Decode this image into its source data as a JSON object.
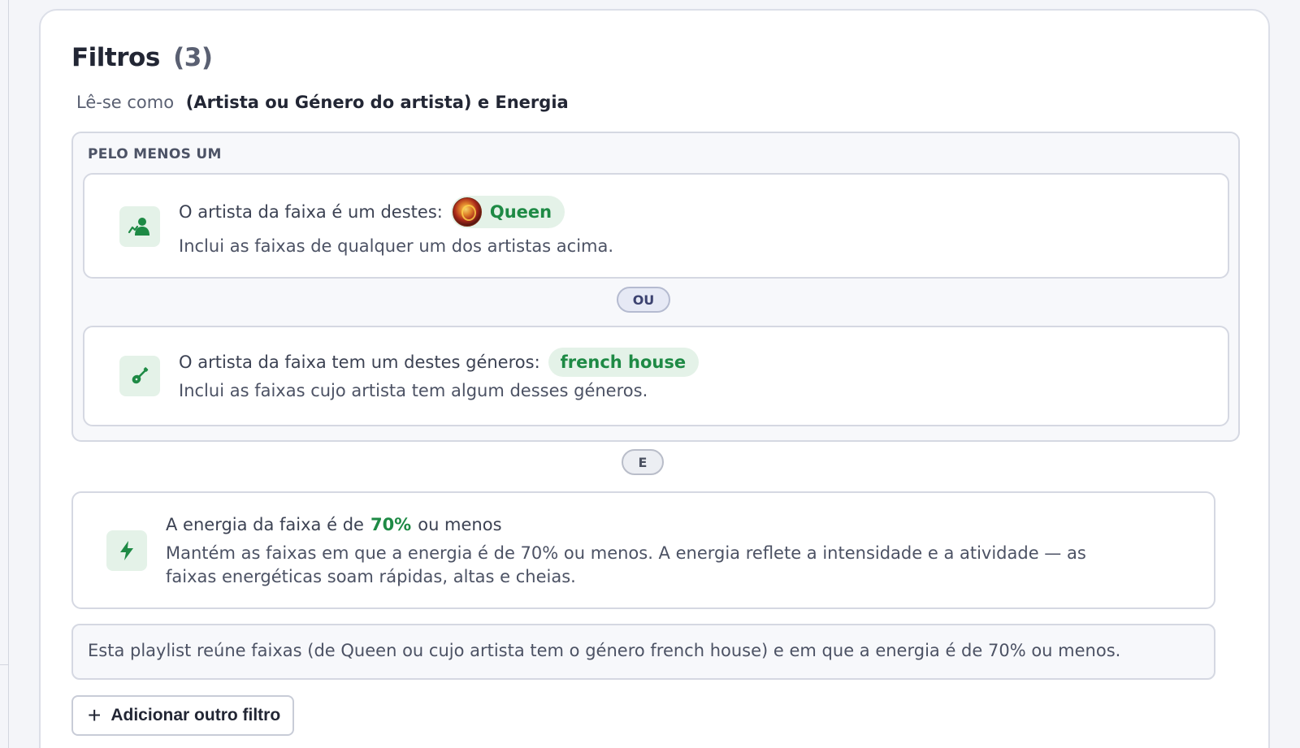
{
  "filters": {
    "title": "Filtros",
    "count": "(3)",
    "reads_as_label": "Lê-se como",
    "reads_as_expression": "(Artista ou Género do artista) e Energia",
    "group": {
      "label": "PELO MENOS UM",
      "rules": [
        {
          "icon": "artist-icon",
          "text": "O artista da faixa é um destes:",
          "chip": "Queen",
          "description": "Inclui as faixas de qualquer um dos artistas acima."
        },
        {
          "icon": "guitar-icon",
          "text": "O artista da faixa tem um destes géneros:",
          "chip": "french house",
          "description": "Inclui as faixas cujo artista tem algum desses géneros."
        }
      ],
      "connector": "OU"
    },
    "and_connector": "E",
    "energy_rule": {
      "icon": "lightning-icon",
      "text_before": "A energia da faixa é de",
      "value": "70%",
      "text_after": "ou menos",
      "description": "Mantém as faixas em que a energia é de 70% ou menos. A energia reflete a intensidade e a atividade — as faixas energéticas soam rápidas, altas e cheias."
    },
    "summary": "Esta playlist reúne faixas (de Queen ou cujo artista tem o género french house) e em que a energia é de 70% ou menos.",
    "add_button_label": "Adicionar outro filtro"
  },
  "colors": {
    "accent_green": "#1e8a45",
    "chip_bg": "#e4f2e8",
    "connector_bg": "#e6e9f5"
  }
}
